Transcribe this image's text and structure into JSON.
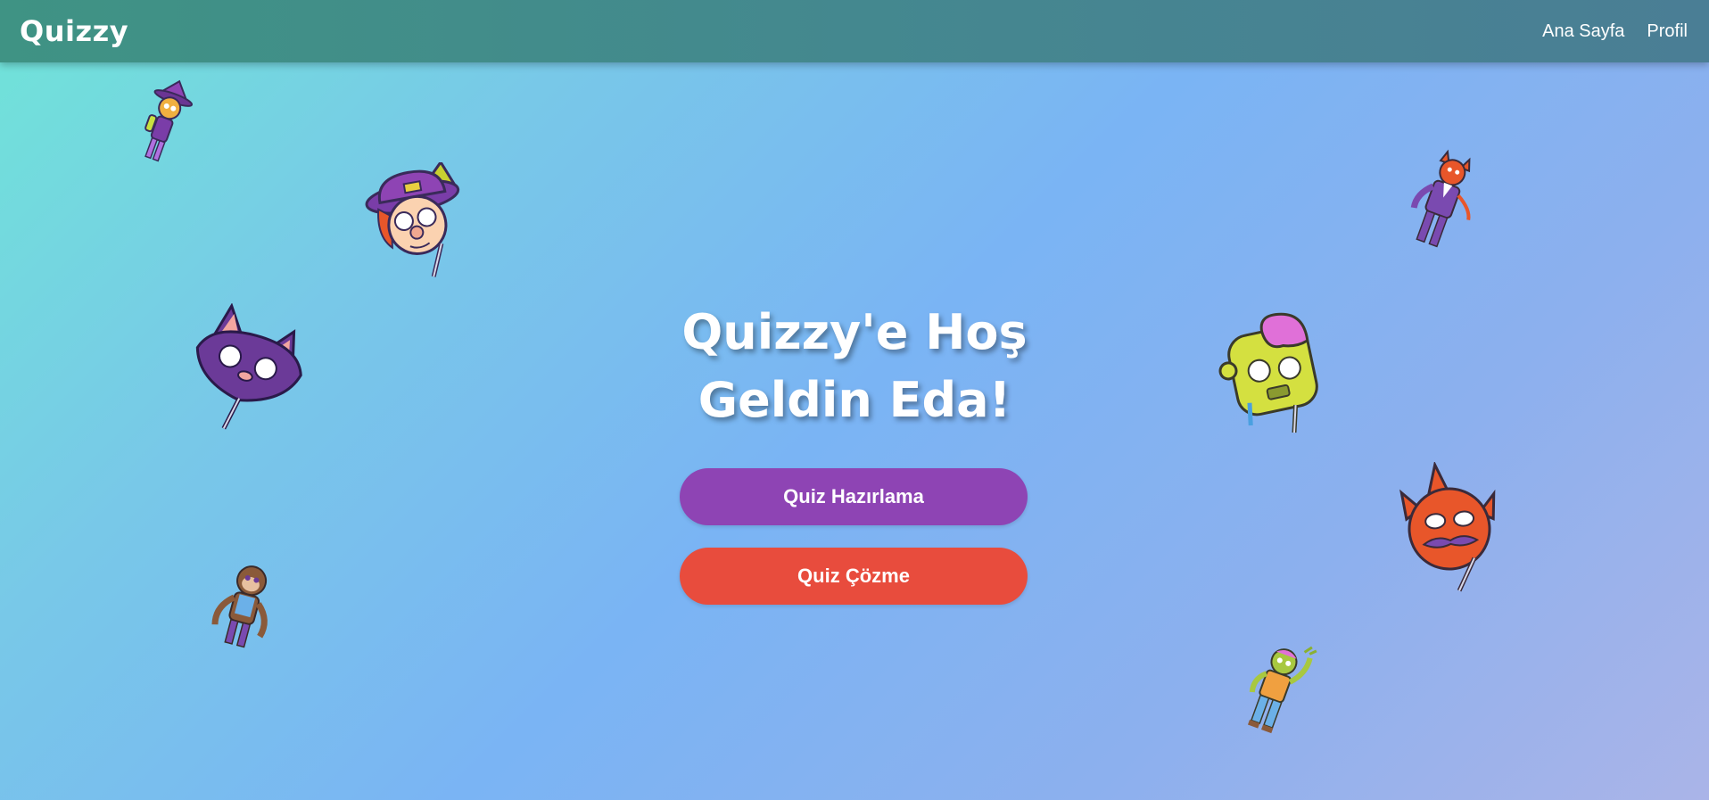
{
  "navbar": {
    "brand": "Quizzy",
    "links": [
      {
        "label": "Ana Sayfa"
      },
      {
        "label": "Profil"
      }
    ]
  },
  "hero": {
    "welcome_line1": "Quizzy'e Hoş",
    "welcome_line2": "Geldin Eda!",
    "create_quiz_label": "Quiz Hazırlama",
    "solve_quiz_label": "Quiz Çözme"
  },
  "colors": {
    "navbar_start": "#3f9384",
    "navbar_end": "#4a7e95",
    "create_button": "#8e44b4",
    "solve_button": "#e84c3d"
  },
  "decorations": [
    {
      "icon": "witch-character-icon"
    },
    {
      "icon": "witch-mask-icon"
    },
    {
      "icon": "bat-mask-icon"
    },
    {
      "icon": "monkey-character-icon"
    },
    {
      "icon": "devil-character-icon"
    },
    {
      "icon": "zombie-mask-icon"
    },
    {
      "icon": "devil-mask-icon"
    },
    {
      "icon": "zombie-character-icon"
    }
  ]
}
